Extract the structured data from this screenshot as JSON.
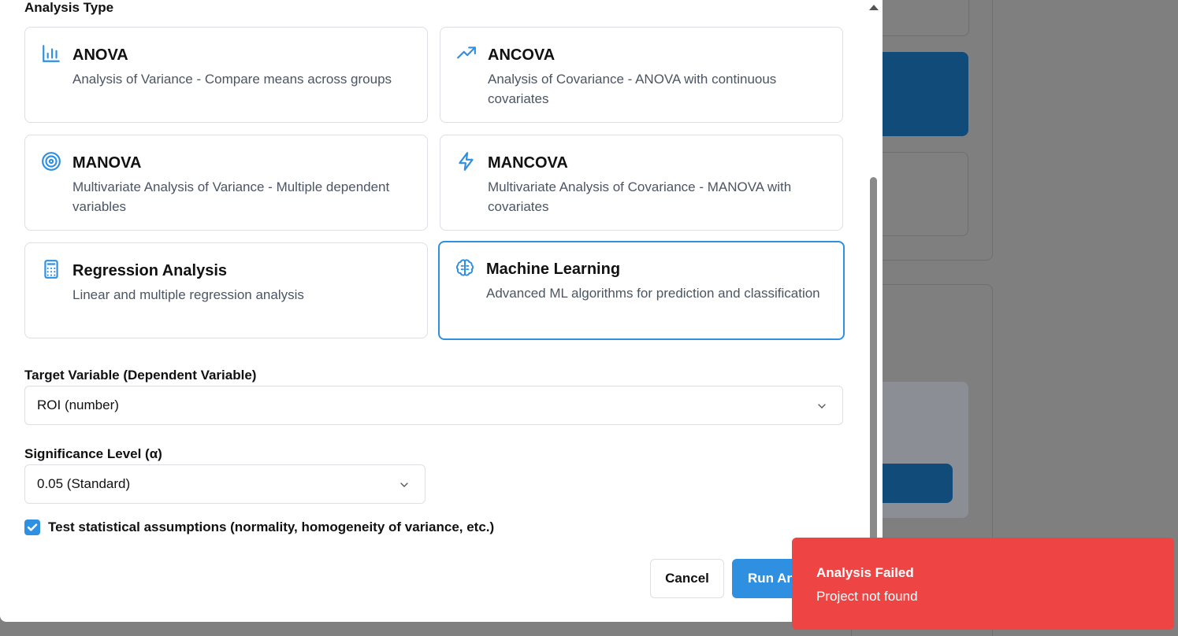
{
  "dialog": {
    "section_label": "Analysis Type",
    "analysis_types": [
      {
        "title": "ANOVA",
        "description": "Analysis of Variance - Compare means across groups",
        "icon": "bar-chart-icon"
      },
      {
        "title": "ANCOVA",
        "description": "Analysis of Covariance - ANOVA with continuous covariates",
        "icon": "trending-up-icon"
      },
      {
        "title": "MANOVA",
        "description": "Multivariate Analysis of Variance - Multiple dependent variables",
        "icon": "target-icon"
      },
      {
        "title": "MANCOVA",
        "description": "Multivariate Analysis of Covariance - MANOVA with covariates",
        "icon": "lightning-icon"
      },
      {
        "title": "Regression Analysis",
        "description": "Linear and multiple regression analysis",
        "icon": "calculator-icon"
      },
      {
        "title": "Machine Learning",
        "description": "Advanced ML algorithms for prediction and classification",
        "icon": "brain-icon",
        "selected": true
      }
    ],
    "target_variable": {
      "label": "Target Variable (Dependent Variable)",
      "value": "ROI (number)"
    },
    "significance_level": {
      "label": "Significance Level (α)",
      "value": "0.05 (Standard)"
    },
    "assumptions_checkbox": {
      "label": "Test statistical assumptions (normality, homogeneity of variance, etc.)",
      "checked": true
    },
    "buttons": {
      "cancel": "Cancel",
      "run": "Run Analysis"
    }
  },
  "toast": {
    "title": "Analysis Failed",
    "message": "Project not found"
  },
  "colors": {
    "accent": "#2f8fe0",
    "error": "#ef4444",
    "overlay": "#7f7f7f"
  }
}
